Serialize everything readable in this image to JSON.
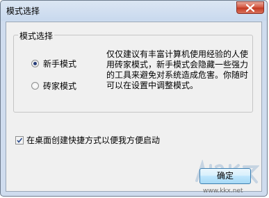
{
  "window": {
    "title": "模式选择"
  },
  "group": {
    "label": "模式选择",
    "options": [
      {
        "label": "新手模式",
        "selected": true
      },
      {
        "label": "砖家模式",
        "selected": false
      }
    ],
    "description": "仅仅建议有丰富计算机使用经验的人使用砖家模式，新手模式会隐藏一些强力的工具来避免对系统造成危害。你随时可以在设置中调整模式。"
  },
  "checkbox": {
    "label": "在桌面创建快捷方式以便我方便启动",
    "checked": true
  },
  "buttons": {
    "ok_label": "确定"
  },
  "watermark": {
    "url": "www.kkx.net"
  },
  "icons": {
    "close": "close-icon",
    "check": "checkmark-icon"
  }
}
